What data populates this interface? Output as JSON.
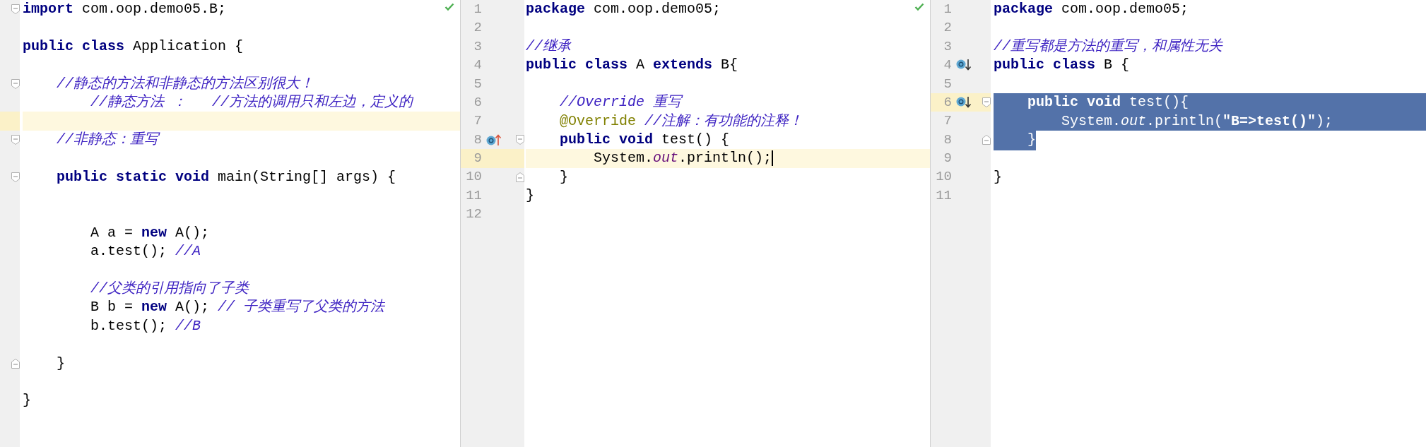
{
  "panes": [
    {
      "check_ok": true,
      "lines": [
        {
          "current": false,
          "fold": {
            "kind": "open"
          },
          "tokens": [
            {
              "kind": "keyword",
              "text": "import"
            },
            {
              "kind": "plain",
              "text": " com.oop.demo05.B;"
            }
          ]
        },
        {
          "current": false
        },
        {
          "current": false,
          "tokens": [
            {
              "kind": "keyword",
              "text": "public class"
            },
            {
              "kind": "plain",
              "text": " Application {"
            }
          ]
        },
        {
          "current": false
        },
        {
          "current": false,
          "fold": {
            "kind": "open"
          },
          "tokens": [
            {
              "kind": "comment",
              "text": "    //静态的方法和非静态的方法区别很大！"
            }
          ]
        },
        {
          "current": false,
          "tokens": [
            {
              "kind": "comment",
              "text": "        //静态方法 ：   //方法的调用只和左边，定义的"
            }
          ]
        },
        {
          "current": true
        },
        {
          "current": false,
          "fold": {
            "kind": "open"
          },
          "tokens": [
            {
              "kind": "comment",
              "text": "    //非静态：重写"
            }
          ]
        },
        {
          "current": false
        },
        {
          "current": false,
          "fold": {
            "kind": "open"
          },
          "tokens": [
            {
              "kind": "keyword",
              "text": "    public static void"
            },
            {
              "kind": "plain",
              "text": " main(String[] args) {"
            }
          ]
        },
        {
          "current": false
        },
        {
          "current": false
        },
        {
          "current": false,
          "tokens": [
            {
              "kind": "plain",
              "text": "        A a = "
            },
            {
              "kind": "keyword",
              "text": "new"
            },
            {
              "kind": "plain",
              "text": " A();"
            }
          ]
        },
        {
          "current": false,
          "tokens": [
            {
              "kind": "plain",
              "text": "        a.test(); "
            },
            {
              "kind": "comment",
              "text": "//A"
            }
          ]
        },
        {
          "current": false
        },
        {
          "current": false,
          "tokens": [
            {
              "kind": "comment",
              "text": "        //父类的引用指向了子类"
            }
          ]
        },
        {
          "current": false,
          "tokens": [
            {
              "kind": "plain",
              "text": "        B b = "
            },
            {
              "kind": "keyword",
              "text": "new"
            },
            {
              "kind": "plain",
              "text": " A(); "
            },
            {
              "kind": "comment",
              "text": "// 子类重写了父类的方法"
            }
          ]
        },
        {
          "current": false,
          "tokens": [
            {
              "kind": "plain",
              "text": "        b.test(); "
            },
            {
              "kind": "comment",
              "text": "//B"
            }
          ]
        },
        {
          "current": false
        },
        {
          "current": false,
          "fold": {
            "kind": "close"
          },
          "tokens": [
            {
              "kind": "plain",
              "text": "    }"
            }
          ]
        },
        {
          "current": false
        },
        {
          "current": false,
          "tokens": [
            {
              "kind": "plain",
              "text": "}"
            }
          ]
        }
      ]
    },
    {
      "check_ok": true,
      "lines": [
        {
          "number": "1",
          "current": false,
          "tokens": [
            {
              "kind": "keyword",
              "text": "package"
            },
            {
              "kind": "plain",
              "text": " com.oop.demo05;"
            }
          ]
        },
        {
          "number": "2",
          "current": false
        },
        {
          "number": "3",
          "current": false,
          "tokens": [
            {
              "kind": "comment",
              "text": "//继承"
            }
          ]
        },
        {
          "number": "4",
          "current": false,
          "tokens": [
            {
              "kind": "keyword",
              "text": "public class"
            },
            {
              "kind": "plain",
              "text": " A "
            },
            {
              "kind": "keyword",
              "text": "extends"
            },
            {
              "kind": "plain",
              "text": " B{"
            }
          ]
        },
        {
          "number": "5",
          "current": false
        },
        {
          "number": "6",
          "current": false,
          "tokens": [
            {
              "kind": "comment",
              "text": "    //Override 重写"
            }
          ]
        },
        {
          "number": "7",
          "current": false,
          "tokens": [
            {
              "kind": "annotation",
              "text": "    @Override"
            },
            {
              "kind": "comment",
              "text": " //注解：有功能的注释！"
            }
          ]
        },
        {
          "number": "8",
          "current": false,
          "marker": {
            "kind": "up"
          },
          "fold": {
            "kind": "open"
          },
          "tokens": [
            {
              "kind": "keyword",
              "text": "    public void"
            },
            {
              "kind": "plain",
              "text": " test() {"
            }
          ]
        },
        {
          "number": "9",
          "current": true,
          "caret": true,
          "tokens": [
            {
              "kind": "plain",
              "text": "        System."
            },
            {
              "kind": "field",
              "text": "out"
            },
            {
              "kind": "plain",
              "text": ".println();"
            }
          ]
        },
        {
          "number": "10",
          "current": false,
          "fold": {
            "kind": "close"
          },
          "tokens": [
            {
              "kind": "plain",
              "text": "    }"
            }
          ]
        },
        {
          "number": "11",
          "current": false,
          "tokens": [
            {
              "kind": "plain",
              "text": "}"
            }
          ]
        },
        {
          "number": "12",
          "current": false
        }
      ]
    },
    {
      "check_ok": false,
      "lines": [
        {
          "number": "1",
          "current": false,
          "selected": false,
          "tokens": [
            {
              "kind": "keyword",
              "text": "package"
            },
            {
              "kind": "plain",
              "text": " com.oop.demo05;"
            }
          ]
        },
        {
          "number": "2",
          "current": false,
          "selected": false
        },
        {
          "number": "3",
          "current": false,
          "selected": false,
          "tokens": [
            {
              "kind": "comment",
              "text": "//重写都是方法的重写，和属性无关"
            }
          ]
        },
        {
          "number": "4",
          "current": false,
          "selected": false,
          "marker": {
            "kind": "down"
          },
          "tokens": [
            {
              "kind": "keyword",
              "text": "public class"
            },
            {
              "kind": "plain",
              "text": " B {"
            }
          ]
        },
        {
          "number": "5",
          "current": false,
          "selected": false
        },
        {
          "number": "6",
          "current": true,
          "selected": true,
          "marker": {
            "kind": "down"
          },
          "fold": {
            "kind": "open"
          },
          "tokens": [
            {
              "kind": "keyword",
              "text": "    public void"
            },
            {
              "kind": "plain",
              "text": " test(){"
            }
          ]
        },
        {
          "number": "7",
          "current": false,
          "selected": true,
          "tokens": [
            {
              "kind": "plain",
              "text": "        System."
            },
            {
              "kind": "field",
              "text": "out"
            },
            {
              "kind": "plain",
              "text": ".println("
            },
            {
              "kind": "string",
              "text": "\"B=>test()\""
            },
            {
              "kind": "plain",
              "text": ");"
            }
          ]
        },
        {
          "number": "8",
          "current": false,
          "selected": true,
          "fold": {
            "kind": "close"
          },
          "tokens": [
            {
              "kind": "plain",
              "text": "    }"
            }
          ]
        },
        {
          "number": "9",
          "current": false,
          "selected": false
        },
        {
          "number": "10",
          "current": false,
          "selected": false,
          "tokens": [
            {
              "kind": "plain",
              "text": "}"
            }
          ]
        },
        {
          "number": "11",
          "current": false,
          "selected": false
        }
      ]
    }
  ]
}
